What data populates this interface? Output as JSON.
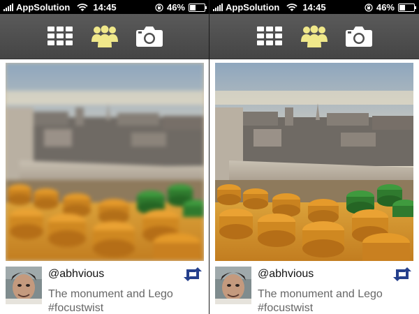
{
  "status_bar": {
    "carrier": "AppSolution",
    "time": "14:45",
    "battery": "46%",
    "battery_level": 0.46
  },
  "toolbar": {
    "items": [
      {
        "icon": "grid-icon",
        "active": false
      },
      {
        "icon": "people-icon",
        "active": true
      },
      {
        "icon": "camera-icon",
        "active": false
      }
    ],
    "active_color": "#f0e88a",
    "inactive_color": "#ffffff"
  },
  "screens": [
    {
      "photo_state": "blurred",
      "post": {
        "username": "@abhvious",
        "caption": "The monument and Lego #focustwist",
        "action_icon": "retweet-icon",
        "action_color": "#243f8c"
      }
    },
    {
      "photo_state": "focused",
      "post": {
        "username": "@abhvious",
        "caption": "The monument and Lego #focustwist",
        "action_icon": "retweet-icon",
        "action_color": "#243f8c"
      }
    }
  ]
}
